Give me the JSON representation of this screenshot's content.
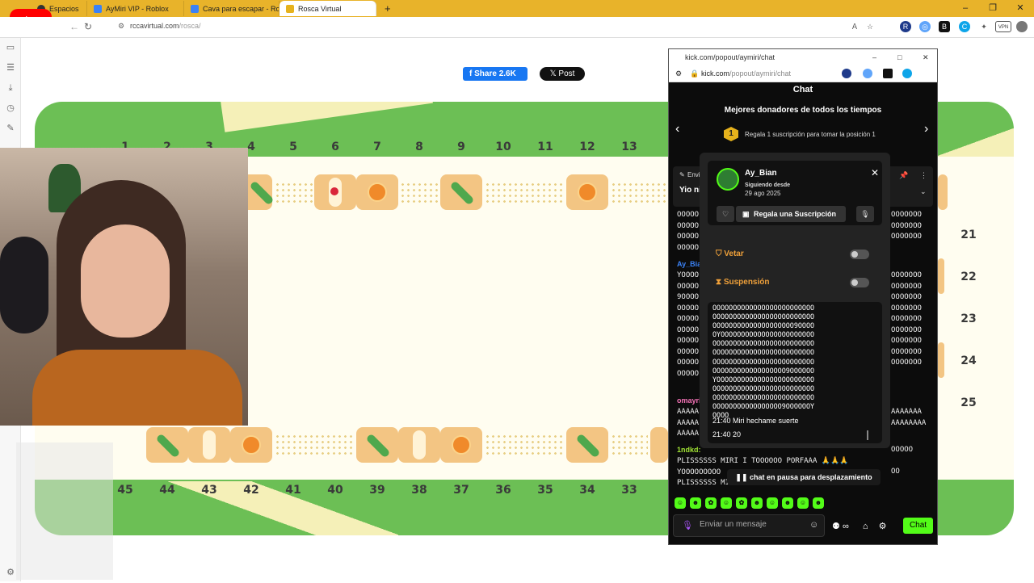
{
  "browser": {
    "tabs": [
      {
        "label": "Espacios",
        "color": "#333"
      },
      {
        "label": "AyMiri VIP - Roblox",
        "color": "#3b82f6"
      },
      {
        "label": "Cava para escapar - Rol",
        "color": "#3b82f6"
      },
      {
        "label": "Rosca Virtual",
        "color": "#e6b21c"
      }
    ],
    "new_tab": "+",
    "url_host": "rc",
    "url_domain": "cavirtual.com",
    "url_path": "/rosca/",
    "win_controls": [
      "–",
      "❐",
      "✕"
    ]
  },
  "page": {
    "share_label": "Share",
    "share_count": "2.6K",
    "post_label": "Post",
    "top_numbers": [
      "1",
      "2",
      "3",
      "4",
      "5",
      "6",
      "7",
      "8",
      "9",
      "10",
      "11",
      "12",
      "13"
    ],
    "right_numbers": [
      "21",
      "22",
      "23",
      "24",
      "25"
    ],
    "bottom_numbers": [
      "45",
      "44",
      "43",
      "42",
      "41",
      "40",
      "39",
      "38",
      "37",
      "36",
      "35",
      "34",
      "33"
    ]
  },
  "popup": {
    "title": "kick.com/popout/aymiri/chat",
    "addr_domain": "kick.com",
    "addr_path": "/popout/aymiri/chat",
    "chat_header": "Chat",
    "donors_title": "Mejores donadores de todos los tiempos",
    "gift_rank": "1",
    "gift_text": "Regala 1 suscripción para tomar la posición 1",
    "pinned_label": "Envi",
    "pinned_text": "Yio ni",
    "left_msgs": {
      "block1": "OOOOO\nOOOOO\nOOOOO\nOOOOO",
      "user1": "Ay_Bia",
      "block2": "YOOOO\nOOOOO\n9OOOO\nOOOOO\nOOOOO\nOOOOO\nOOOOO\nOOOOO\nOOOOO\nOOOOO",
      "user2": "omayri",
      "block3": "AAAAA\nAAAAA\nAAAAA",
      "user3": "1ndkd:",
      "block4": "PLISSSSSS MIRI I TOOOOOO PORFAAA 🙏🙏🙏\nYOOOOOOOOO\nPLISSSSSS MIRI"
    },
    "right_msgs": {
      "block1": "OOOOOOO\nOOOOOOO\nOOOOOOO",
      "block2": "OOOOOOO\nOOOOOOO\nOOOOOOO\nOOOOOOO\nOOOOOOO\nOOOOOOO\nOOOOOOO\nOOOOOOO\nOOOOOOO",
      "block3": "AAAAAAA\nAAAAAAAA",
      "block4": "OOOOO",
      "block5": "OO"
    },
    "card": {
      "username": "Ay_Bian",
      "following_label": "Siguiendo desde",
      "following_date": "29 ago 2025",
      "gift_button": "Regala una Suscripción",
      "ban_label": "Vetar",
      "timeout_label": "Suspensión",
      "message_text": "OOOOOOOOOOOOOOOOOOOOOOOOO\nOOOOOOOOOOOOOOOOOOOOOOOOO\nOOOOOOOOOOOOOOOOOOOO9OOOO\nOYOOOOOOOOOOOOOOOOOOOOOOO\nOOOOOOOOOOOOOOOOOOOOOOOOO\nOOOOOOOOOOOOOOOOOOOOOOOOO\nOOOOOOOOOOOOOOOOOOOOOOOOO\nOOOOOOOOOOOOOOOOOO9OOOOOO\nYOOOOOOOOOOOOOOOOOOOOOOOO\nOOOOOOOOOOOOOOOOOOOOOOOOO\nOOOOOOOOOOOOOOOOOOOOOOOOO\nOOOOOOOOOOOOOOOOO9OOOOOOY\nOOOO",
      "line1": "21:40 Miri hechame suerte",
      "line2": "21:40 20"
    },
    "paused_text": "chat en pausa para desplazamiento",
    "input_placeholder": "Enviar un mensaje",
    "chat_button": "Chat",
    "infinity": "∞"
  }
}
